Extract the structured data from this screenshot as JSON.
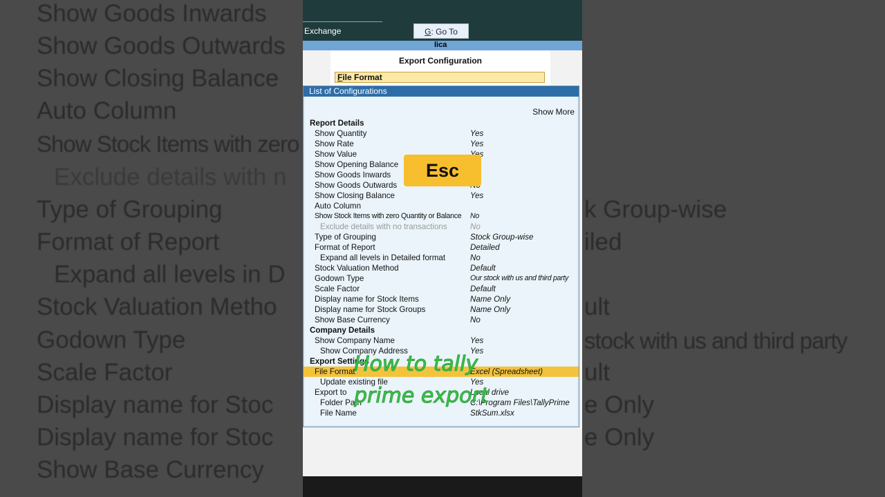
{
  "background_lines": [
    {
      "text": "Show Goods Inwards"
    },
    {
      "text": "Show Goods Outwards"
    },
    {
      "text": "Show Closing Balance"
    },
    {
      "text": "Auto Column"
    },
    {
      "text": "Show Stock Items with zero"
    },
    {
      "text": "Exclude details with n"
    },
    {
      "text": "Type of Grouping"
    },
    {
      "text": "Format of Report"
    },
    {
      "text": "Expand all levels in D"
    },
    {
      "text": "Stock Valuation Metho"
    },
    {
      "text": "Godown Type"
    },
    {
      "text": "Scale Factor"
    },
    {
      "text": "Display name for Stoc"
    },
    {
      "text": "Display name for Stoc"
    },
    {
      "text": "Show Base Currency"
    }
  ],
  "background_right": [
    {
      "text": "k Group-wise"
    },
    {
      "text": "iled"
    },
    {
      "text": "ult"
    },
    {
      "text": "stock with us and third party"
    },
    {
      "text": "ult"
    },
    {
      "text": "e Only"
    },
    {
      "text": "e Only"
    }
  ],
  "topbar": {
    "exchange_label": "Exchange",
    "goto_key": "G",
    "goto_label": ": Go To",
    "company_fragment": "lica"
  },
  "export_config": {
    "title": "Export Configuration",
    "field_key": "F",
    "field_label": "ile Format"
  },
  "list": {
    "title": "List of Configurations",
    "show_more": "Show More",
    "rows": [
      {
        "label": "Report Details",
        "value": "",
        "type": "section"
      },
      {
        "label": "Show Quantity",
        "value": "Yes",
        "type": "item"
      },
      {
        "label": "Show Rate",
        "value": "Yes",
        "type": "item"
      },
      {
        "label": "Show Value",
        "value": "Yes",
        "type": "item"
      },
      {
        "label": "Show Opening Balance",
        "value": "",
        "type": "item"
      },
      {
        "label": "Show Goods Inwards",
        "value": "",
        "type": "item"
      },
      {
        "label": "Show Goods Outwards",
        "value": "No",
        "type": "item"
      },
      {
        "label": "Show Closing Balance",
        "value": "Yes",
        "type": "item"
      },
      {
        "label": "Auto Column",
        "value": "",
        "type": "item"
      },
      {
        "label": "Show Stock Items with zero Quantity or Balance",
        "value": "No",
        "type": "cond"
      },
      {
        "label": "Exclude details with no transactions",
        "value": "No",
        "type": "grey"
      },
      {
        "label": "Type of Grouping",
        "value": "Stock Group-wise",
        "type": "item"
      },
      {
        "label": "Format of Report",
        "value": "Detailed",
        "type": "item"
      },
      {
        "label": "Expand all levels in Detailed format",
        "value": "No",
        "type": "sub"
      },
      {
        "label": "Stock Valuation Method",
        "value": "Default",
        "type": "item"
      },
      {
        "label": "Godown Type",
        "value": "Our stock with us and third party",
        "type": "item-condval"
      },
      {
        "label": "Scale Factor",
        "value": "Default",
        "type": "item"
      },
      {
        "label": "Display name for Stock Items",
        "value": "Name Only",
        "type": "item"
      },
      {
        "label": "Display name for Stock Groups",
        "value": "Name Only",
        "type": "item"
      },
      {
        "label": "Show Base Currency",
        "value": "No",
        "type": "item"
      },
      {
        "label": "Company Details",
        "value": "",
        "type": "section"
      },
      {
        "label": "Show Company Name",
        "value": "Yes",
        "type": "item"
      },
      {
        "label": "Show Company Address",
        "value": "Yes",
        "type": "sub"
      },
      {
        "label": "Export Settings",
        "value": "",
        "type": "section"
      },
      {
        "label": "File Format",
        "value": "Excel (Spreadsheet)",
        "type": "highlight"
      },
      {
        "label": "Update existing file",
        "value": "Yes",
        "type": "sub"
      },
      {
        "label": "Export to",
        "value": "Local drive",
        "type": "item"
      },
      {
        "label": "Folder Path",
        "value": "C:\\Program Files\\TallyPrime",
        "type": "sub"
      },
      {
        "label": "File Name",
        "value": "StkSum.xlsx",
        "type": "sub"
      }
    ]
  },
  "overlay": {
    "esc_label": "Esc",
    "caption_line1": "How to tally",
    "caption_line2": "prime export"
  },
  "colors": {
    "topbar": "#1f3b3b",
    "panel_title": "#2e6ea8",
    "highlight": "#f3c33c",
    "esc_badge": "#f7be2e",
    "caption": "#3cc24a"
  }
}
